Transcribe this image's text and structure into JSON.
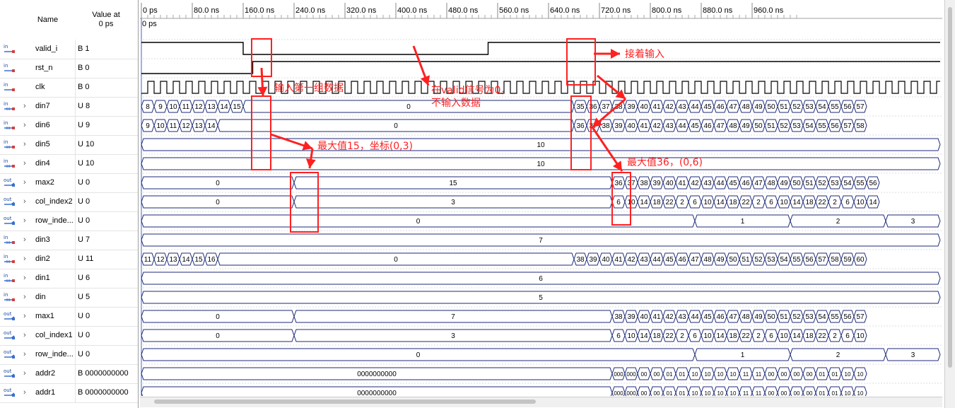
{
  "header": {
    "name_col": "Name",
    "value_col_l1": "Value at",
    "value_col_l2": "0 ps"
  },
  "time_ticks": [
    "0 ps",
    "80.0 ns",
    "160.0 ns",
    "240.0 ns",
    "320.0 ns",
    "400.0 ns",
    "480.0 ns",
    "560.0 ns",
    "640.0 ns",
    "720.0 ns",
    "800.0 ns",
    "880.0 ns",
    "960.0 ns"
  ],
  "cursor_label": "0 ps",
  "signals": [
    {
      "icon": "in",
      "name": "valid_i",
      "value": "B 1",
      "expand": false
    },
    {
      "icon": "in",
      "name": "rst_n",
      "value": "B 0",
      "expand": false
    },
    {
      "icon": "in",
      "name": "clk",
      "value": "B 0",
      "expand": false
    },
    {
      "icon": "bus-in",
      "name": "din7",
      "value": "U 8",
      "expand": true
    },
    {
      "icon": "bus-in",
      "name": "din6",
      "value": "U 9",
      "expand": true
    },
    {
      "icon": "bus-in",
      "name": "din5",
      "value": "U 10",
      "expand": true
    },
    {
      "icon": "bus-in",
      "name": "din4",
      "value": "U 10",
      "expand": true
    },
    {
      "icon": "out",
      "name": "max2",
      "value": "U 0",
      "expand": true
    },
    {
      "icon": "out",
      "name": "col_index2",
      "value": "U 0",
      "expand": true
    },
    {
      "icon": "out",
      "name": "row_inde...",
      "value": "U 0",
      "expand": true
    },
    {
      "icon": "bus-in",
      "name": "din3",
      "value": "U 7",
      "expand": true
    },
    {
      "icon": "bus-in",
      "name": "din2",
      "value": "U 11",
      "expand": true
    },
    {
      "icon": "bus-in",
      "name": "din1",
      "value": "U 6",
      "expand": true
    },
    {
      "icon": "bus-in",
      "name": "din",
      "value": "U 5",
      "expand": true
    },
    {
      "icon": "out",
      "name": "max1",
      "value": "U 0",
      "expand": true
    },
    {
      "icon": "out",
      "name": "col_index1",
      "value": "U 0",
      "expand": true
    },
    {
      "icon": "out",
      "name": "row_inde...",
      "value": "U 0",
      "expand": true
    },
    {
      "icon": "out",
      "name": "addr2",
      "value": "B 0000000000",
      "expand": true
    },
    {
      "icon": "out",
      "name": "addr1",
      "value": "B 0000000000",
      "expand": true
    }
  ],
  "buses": {
    "din7": {
      "seq1": [
        "8",
        "9",
        "10",
        "11",
        "12",
        "13",
        "14",
        "15"
      ],
      "mid": "0",
      "seq2": [
        "35",
        "36",
        "37",
        "38",
        "39",
        "40",
        "41",
        "42",
        "43",
        "44",
        "45",
        "46",
        "47",
        "48",
        "49",
        "50",
        "51",
        "52",
        "53",
        "54",
        "55",
        "56",
        "57"
      ]
    },
    "din6": {
      "seq1": [
        "9",
        "10",
        "11",
        "12",
        "13",
        "14"
      ],
      "mid": "0",
      "seq2": [
        "36",
        "37",
        "38",
        "39",
        "40",
        "41",
        "42",
        "43",
        "44",
        "45",
        "46",
        "47",
        "48",
        "49",
        "50",
        "51",
        "52",
        "53",
        "54",
        "55",
        "56",
        "57",
        "58"
      ]
    },
    "din5": "10",
    "din4": "10",
    "max2": {
      "first": "0",
      "mid": "15",
      "seq": [
        "36",
        "37",
        "38",
        "39",
        "40",
        "41",
        "42",
        "43",
        "44",
        "45",
        "46",
        "47",
        "48",
        "49",
        "50",
        "51",
        "52",
        "53",
        "54",
        "55",
        "56"
      ]
    },
    "col_index2": {
      "first": "0",
      "mid": "3",
      "seq": [
        "6",
        "10",
        "14",
        "18",
        "22",
        "2",
        "6",
        "10",
        "14",
        "18",
        "22",
        "2",
        "6",
        "10",
        "14",
        "18",
        "22",
        "2",
        "6",
        "10",
        "14"
      ]
    },
    "row_index2": {
      "v0": "0",
      "v1": "1",
      "v2": "2",
      "v3": "3"
    },
    "din3": "7",
    "din2": {
      "seq1": [
        "11",
        "12",
        "13",
        "14",
        "15",
        "16"
      ],
      "mid": "0",
      "seq2": [
        "38",
        "39",
        "40",
        "41",
        "42",
        "43",
        "44",
        "45",
        "46",
        "47",
        "48",
        "49",
        "50",
        "51",
        "52",
        "53",
        "54",
        "55",
        "56",
        "57",
        "58",
        "59",
        "60"
      ]
    },
    "din1": "6",
    "din": "5",
    "max1": {
      "first": "0",
      "mid": "7",
      "seq": [
        "38",
        "39",
        "40",
        "41",
        "42",
        "43",
        "44",
        "45",
        "46",
        "47",
        "48",
        "49",
        "50",
        "51",
        "52",
        "53",
        "54",
        "55",
        "56",
        "57"
      ]
    },
    "col_index1": {
      "first": "0",
      "mid": "3",
      "seq": [
        "6",
        "10",
        "14",
        "18",
        "22",
        "2",
        "6",
        "10",
        "14",
        "18",
        "22",
        "2",
        "6",
        "10",
        "14",
        "18",
        "22",
        "2",
        "6",
        "10"
      ]
    },
    "row_index1": {
      "v0": "0",
      "v1": "1",
      "v2": "2",
      "v3": "3"
    },
    "addr2": {
      "first": "0000000000",
      "seq": [
        "000",
        "000",
        "00",
        "00",
        "01",
        "01",
        "10",
        "10",
        "10",
        "10",
        "11",
        "11",
        "00",
        "00",
        "00",
        "00",
        "01",
        "01",
        "10",
        "10"
      ]
    },
    "addr1": {
      "first": "0000000000",
      "seq": [
        "000",
        "000",
        "00",
        "00",
        "01",
        "01",
        "10",
        "10",
        "10",
        "10",
        "11",
        "11",
        "00",
        "00",
        "00",
        "00",
        "01",
        "01",
        "10",
        "10"
      ]
    }
  },
  "annotations": {
    "a1": "输入第一组数据",
    "a2_l1": "在valid信号为0，",
    "a2_l2": "不输入数据",
    "a3": "接着输入",
    "a4": "最大值15，坐标(0,3)",
    "a5": "最大值36，(0,6)"
  },
  "colors": {
    "wave": "#000000",
    "bus": "#1c2a7a",
    "anno": "#ff2020",
    "grid": "#d8d8d8"
  }
}
